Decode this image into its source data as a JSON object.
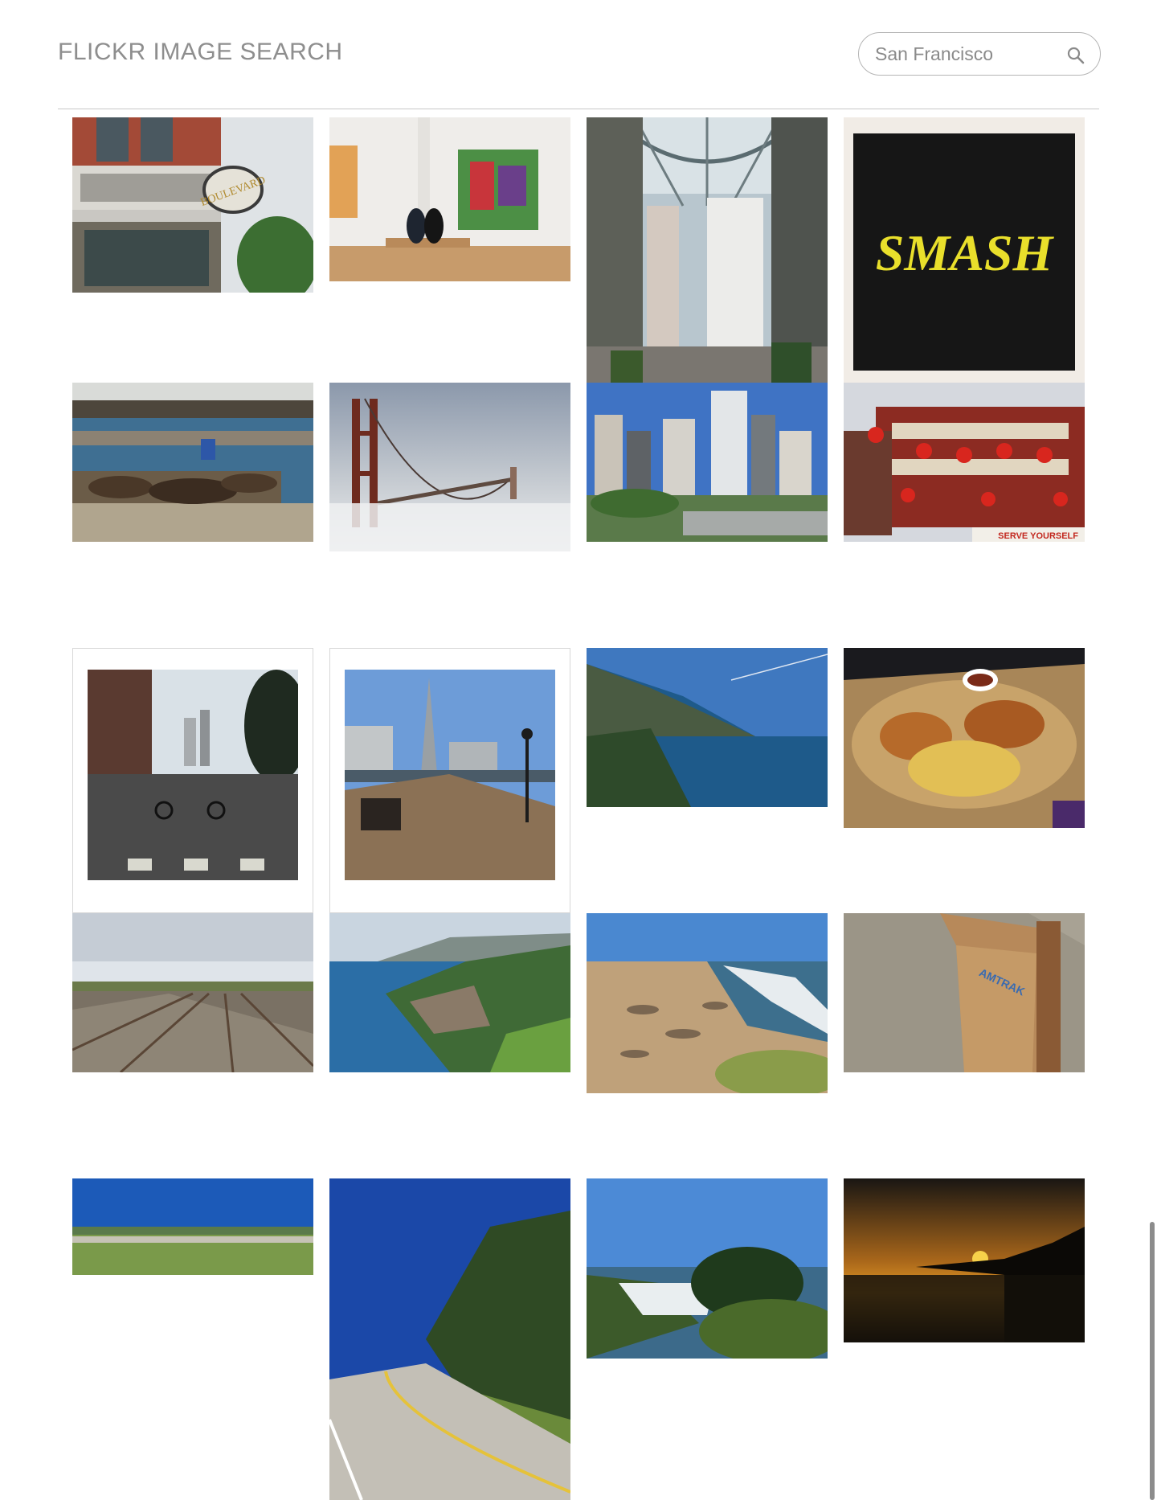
{
  "header": {
    "title": "FLICKR IMAGE SEARCH"
  },
  "search": {
    "value": "San Francisco",
    "icon": "search-icon"
  },
  "photos": [
    {
      "name": "photo-boulevard-building",
      "sign": "BOULEVARD"
    },
    {
      "name": "photo-art-gallery"
    },
    {
      "name": "photo-glass-arcade"
    },
    {
      "name": "photo-smash-painting",
      "text": "SMASH"
    },
    {
      "name": "photo-sea-lions-pier"
    },
    {
      "name": "photo-golden-gate-fog"
    },
    {
      "name": "photo-city-skyscrapers"
    },
    {
      "name": "photo-chinatown-lanterns",
      "sign": "SERVE YOURSELF"
    },
    {
      "name": "photo-cyclists-street"
    },
    {
      "name": "photo-pier-transamerica"
    },
    {
      "name": "photo-coastal-cliffs"
    },
    {
      "name": "photo-wings-fries"
    },
    {
      "name": "photo-railroad-tracks"
    },
    {
      "name": "photo-big-sur-coast"
    },
    {
      "name": "photo-elephant-seals-beach"
    },
    {
      "name": "photo-amtrak-box",
      "sign": "AMTRAK"
    },
    {
      "name": "photo-field-horizon"
    },
    {
      "name": "photo-winding-road"
    },
    {
      "name": "photo-beach-cove-trees"
    },
    {
      "name": "photo-sunset-coast"
    }
  ]
}
